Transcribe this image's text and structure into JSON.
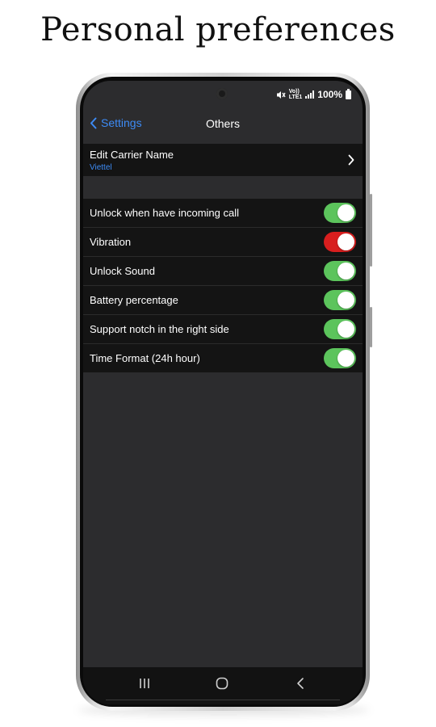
{
  "heading": "Personal preferences",
  "status_bar": {
    "volte_top": "Vo))",
    "volte_bottom": "LTE1",
    "battery": "100%"
  },
  "nav": {
    "back_label": "Settings",
    "title": "Others"
  },
  "carrier": {
    "title": "Edit Carrier Name",
    "value": "Viettel"
  },
  "settings": [
    {
      "label": "Unlock when have incoming call",
      "state": "on",
      "color": "#5cc45c"
    },
    {
      "label": "Vibration",
      "state": "off",
      "color": "#d81e1e"
    },
    {
      "label": "Unlock Sound",
      "state": "on",
      "color": "#5cc45c"
    },
    {
      "label": "Battery percentage",
      "state": "on",
      "color": "#5cc45c"
    },
    {
      "label": "Support notch in the right side",
      "state": "on",
      "color": "#5cc45c"
    },
    {
      "label": "Time Format (24h hour)",
      "state": "on",
      "color": "#5cc45c"
    }
  ],
  "colors": {
    "accent": "#3d8bf5",
    "screen_bg": "#2c2c2e",
    "row_bg": "#141414"
  },
  "icons": {
    "back": "chevron-left-icon",
    "disclosure": "chevron-right-icon",
    "mute": "mute-icon",
    "signal": "signal-icon",
    "battery": "battery-icon",
    "recents": "recents-icon",
    "home": "home-icon",
    "system_back": "back-icon"
  }
}
